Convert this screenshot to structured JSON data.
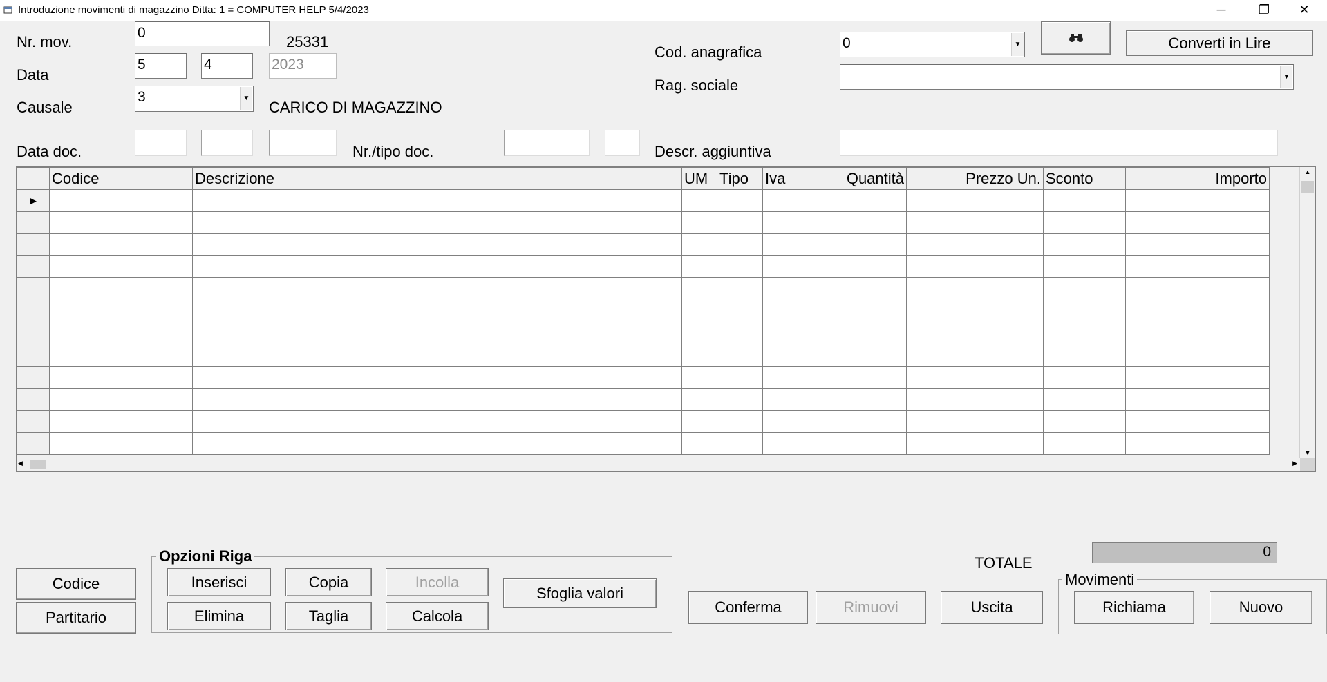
{
  "window": {
    "title": "Introduzione movimenti di magazzino  Ditta: 1 = COMPUTER HELP  5/4/2023",
    "minimize_glyph": "─",
    "maximize_glyph": "❐",
    "close_glyph": "✕"
  },
  "header": {
    "nr_mov_label": "Nr. mov.",
    "nr_mov_value": "0",
    "nr_mov_number": "25331",
    "data_label": "Data",
    "data_day": "5",
    "data_month": "4",
    "data_year": "2023",
    "causale_label": "Causale",
    "causale_value": "3",
    "causale_desc": "CARICO DI MAGAZZINO",
    "data_doc_label": "Data doc.",
    "nr_tipo_doc_label": "Nr./tipo doc.",
    "cod_anagrafica_label": "Cod. anagrafica",
    "cod_anagrafica_value": "0",
    "rag_sociale_label": "Rag. sociale",
    "rag_sociale_value": "",
    "descr_aggiuntiva_label": "Descr. aggiuntiva",
    "search_icon": "binoculars-icon",
    "converti_label": "Converti in Lire"
  },
  "grid": {
    "columns": [
      "Codice",
      "Descrizione",
      "UM",
      "Tipo",
      "Iva",
      "Quantità",
      "Prezzo Un.",
      "Sconto",
      "Importo"
    ],
    "row_count": 12,
    "current_row_indicator": "▶"
  },
  "buttons": {
    "codice": "Codice",
    "partitario": "Partitario",
    "opzioni_riga_title": "Opzioni Riga",
    "inserisci": "Inserisci",
    "copia": "Copia",
    "incolla": "Incolla",
    "elimina": "Elimina",
    "taglia": "Taglia",
    "calcola": "Calcola",
    "sfoglia_valori": "Sfoglia valori",
    "conferma": "Conferma",
    "rimuovi": "Rimuovi",
    "uscita": "Uscita",
    "movimenti_title": "Movimenti",
    "richiama": "Richiama",
    "nuovo": "Nuovo"
  },
  "totale": {
    "label": "TOTALE",
    "value": "0"
  }
}
